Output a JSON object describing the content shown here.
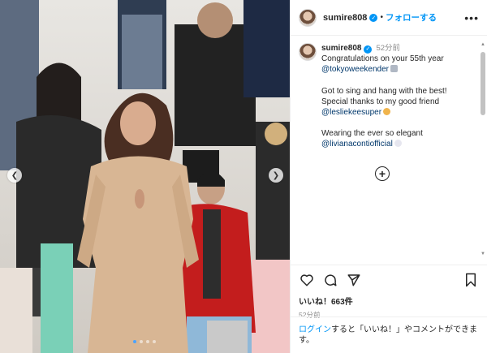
{
  "post": {
    "username": "sumire808",
    "follow_label": "フォローする",
    "separator": "•",
    "more_icon": "more-horizontal-icon",
    "caption": {
      "time": "52分前",
      "line1": "Congratulations on your 55th year",
      "line2": "@tokyoweekender",
      "line3": "Got to sing and hang with the best!",
      "line4": "Special thanks to my good friend",
      "line5": "@lesliekeesuper",
      "line6": "Wearing the ever so elegant",
      "line7": "@livianacontiofficial"
    },
    "load_more_icon": "plus-circle-icon",
    "likes": "いいね！663件",
    "posted": "52分前",
    "login_link": "ログイン",
    "login_text": "すると「いいね！」やコメントができます。",
    "carousel": {
      "slides": 4,
      "active_index": 0
    }
  },
  "colors": {
    "accent": "#0095f6",
    "link": "#00376b",
    "muted": "#8e8e8e"
  }
}
